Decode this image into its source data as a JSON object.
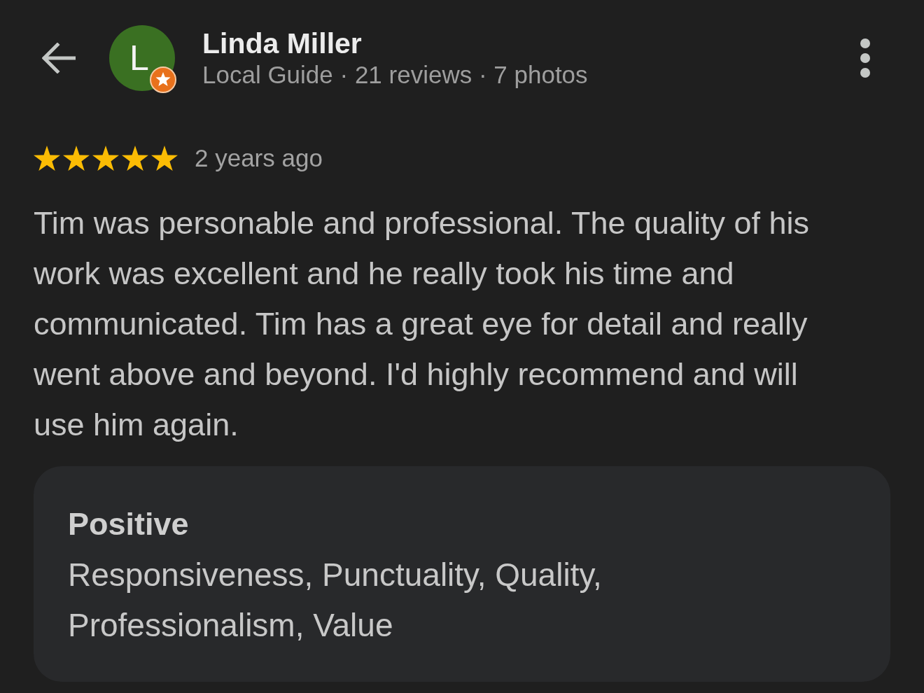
{
  "reviewer": {
    "avatar_letter": "L",
    "local_guide": true,
    "name": "Linda Miller",
    "details": "Local Guide · 21 reviews · 7 photos"
  },
  "review": {
    "stars": 5,
    "time": "2 years ago",
    "text": "Tim was personable and professional. The quality of his work was excellent and he really took his time and communicated. Tim has a great eye for detail and really went above and beyond. I'd highly recommend and will use him again."
  },
  "highlights": {
    "title": "Positive",
    "text": "Responsiveness, Punctuality, Quality, Professionalism, Value"
  }
}
